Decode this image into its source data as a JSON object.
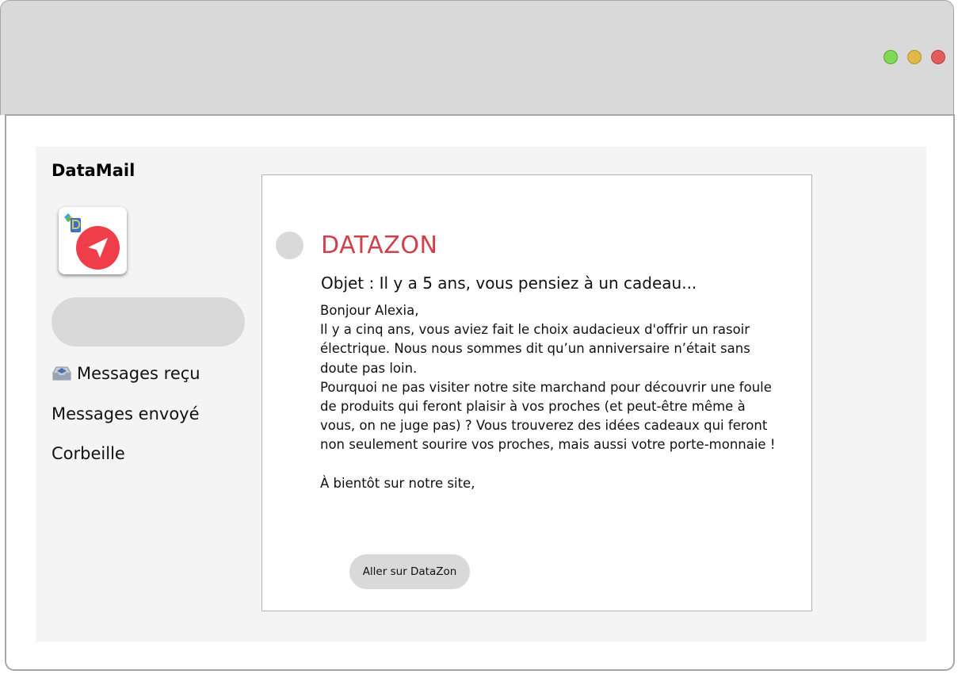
{
  "app": {
    "name": "DataMail"
  },
  "sidebar": {
    "items": [
      {
        "label": "Messages reçu",
        "icon": "inbox-tray-icon"
      },
      {
        "label": "Messages envoyé"
      },
      {
        "label": "Corbeille"
      }
    ]
  },
  "email": {
    "sender": "DATAZON",
    "subject": "Objet : Il y a 5 ans, vous pensiez à un cadeau...",
    "greeting": "Bonjour Alexia,",
    "paragraph1": "Il y a cinq ans, vous aviez fait le choix audacieux d'offrir un rasoir électrique. Nous nous sommes dit qu’un anniversaire n’était sans doute pas loin.",
    "paragraph2": "Pourquoi ne pas visiter notre site marchand pour découvrir une foule de produits qui feront plaisir à vos proches (et peut-être même à vous, on ne juge pas) ? Vous trouverez des idées cadeaux qui feront non seulement sourire vos proches, mais aussi votre porte-monnaie !",
    "closing": "À bientôt sur notre site,",
    "cta_label": "Aller sur DataZon"
  },
  "colors": {
    "sender_accent": "#d1414b",
    "logo_red": "#ef3e4a",
    "window_green": "#7ed957",
    "window_yellow": "#e2b84a",
    "window_red": "#e35d5d"
  }
}
